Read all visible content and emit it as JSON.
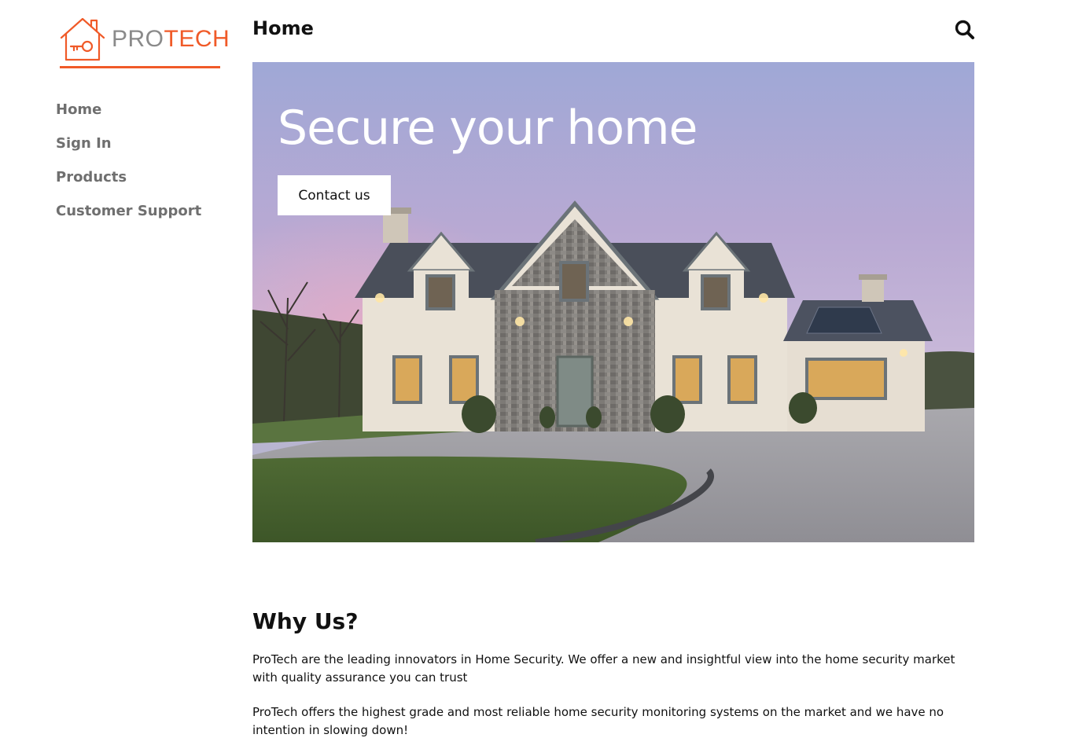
{
  "brand": {
    "name_part1": "PRO",
    "name_part2": "TECH",
    "accent_color": "#f05a28",
    "gray_color": "#8a8a8a",
    "logo_icon": "house-key-icon"
  },
  "sidebar": {
    "items": [
      {
        "label": "Home"
      },
      {
        "label": "Sign In"
      },
      {
        "label": "Products"
      },
      {
        "label": "Customer Support"
      }
    ]
  },
  "header": {
    "title": "Home",
    "search_icon": "search-icon"
  },
  "hero": {
    "title": "Secure your home",
    "button_label": "Contact us",
    "image_subject": "house-photo"
  },
  "why_us": {
    "title": "Why Us?",
    "paragraphs": [
      "ProTech are the leading innovators in Home Security. We offer a new and insightful view into the home security market with quality assurance you can trust",
      "ProTech offers the highest grade and most reliable home security monitoring systems on the market and we have no intention in slowing down!"
    ]
  }
}
